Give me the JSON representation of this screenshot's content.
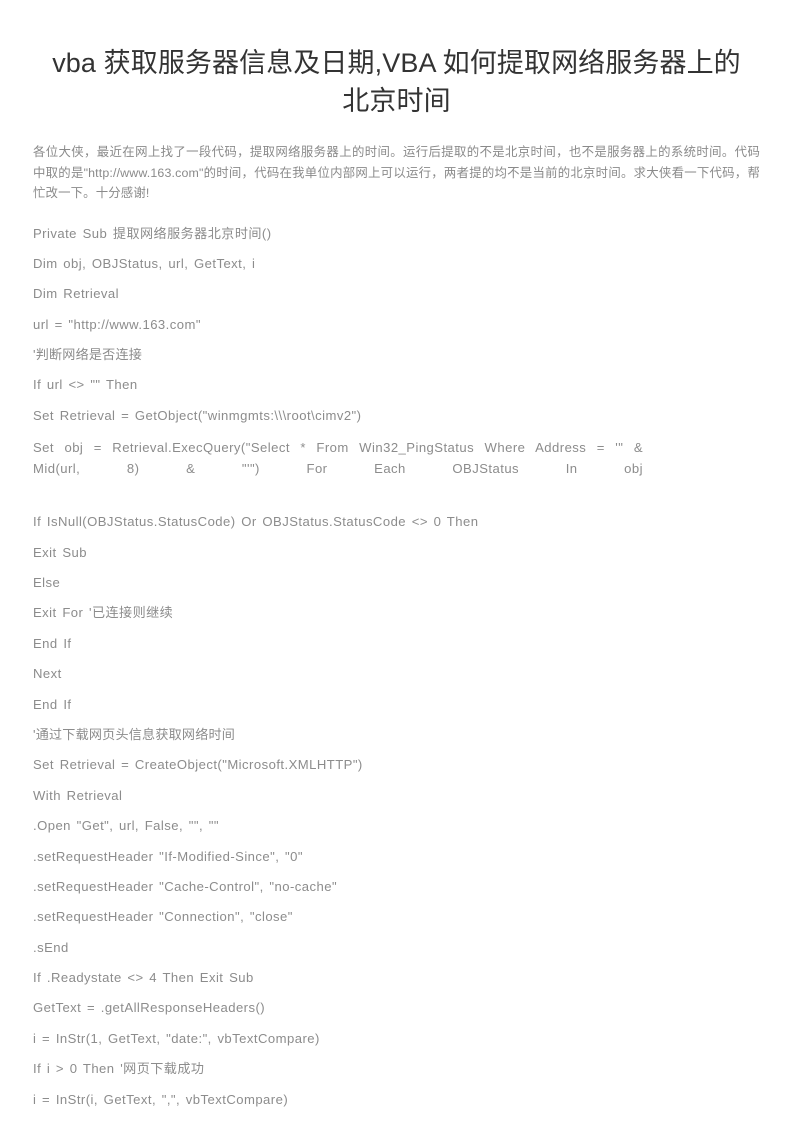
{
  "page": {
    "background_color": "#ffffff",
    "title_color": "#333333",
    "body_text_color": "#8c8c8c",
    "intro_text_color": "#8a8a8a"
  },
  "article": {
    "title": "vba 获取服务器信息及日期,VBA 如何提取网络服务器上的北京时间",
    "intro": "各位大侠，最近在网上找了一段代码，提取网络服务器上的时间。运行后提取的不是北京时间，也不是服务器上的系统时间。代码中取的是\"http://www.163.com\"的时间，代码在我单位内部网上可以运行，两者提的均不是当前的北京时间。求大侠看一下代码，帮忙改一下。十分感谢!",
    "code_lines": [
      "Private  Sub  提取网络服务器北京时间()",
      "Dim  obj,  OBJStatus,  url,  GetText,  i",
      "Dim  Retrieval",
      "url  =  \"http://www.163.com\"",
      "'判断网络是否连接",
      "If  url  <>  \"\"  Then",
      "Set  Retrieval  =  GetObject(\"winmgmts:\\\\\\root\\cimv2\")",
      "Set  obj  =  Retrieval.ExecQuery(\"Select  *  From  Win32_PingStatus  Where  Address  =  '\"  &  Mid(url,  8)  &  \"'\")  For  Each  OBJStatus  In  obj",
      "If  IsNull(OBJStatus.StatusCode)  Or  OBJStatus.StatusCode  <>  0  Then",
      "Exit  Sub",
      "Else",
      "Exit  For  '已连接则继续",
      "End  If",
      "Next",
      "End  If",
      "'通过下载网页头信息获取网络时间",
      "Set  Retrieval  =  CreateObject(\"Microsoft.XMLHTTP\")",
      "With  Retrieval",
      ".Open  \"Get\",  url,  False,  \"\",  \"\"",
      ".setRequestHeader  \"If-Modified-Since\",  \"0\"",
      ".setRequestHeader  \"Cache-Control\",  \"no-cache\"",
      ".setRequestHeader  \"Connection\",  \"close\"",
      ".sEnd",
      "If  .Readystate  <>  4  Then  Exit  Sub",
      "GetText  =  .getAllResponseHeaders()",
      "i  =  InStr(1,  GetText,  \"date:\",  vbTextCompare)",
      "If  i  >  0  Then  '网页下载成功",
      "i  =  InStr(i,  GetText,  \",\",  vbTextCompare)"
    ],
    "wrapped_line_indices": [
      7
    ]
  }
}
